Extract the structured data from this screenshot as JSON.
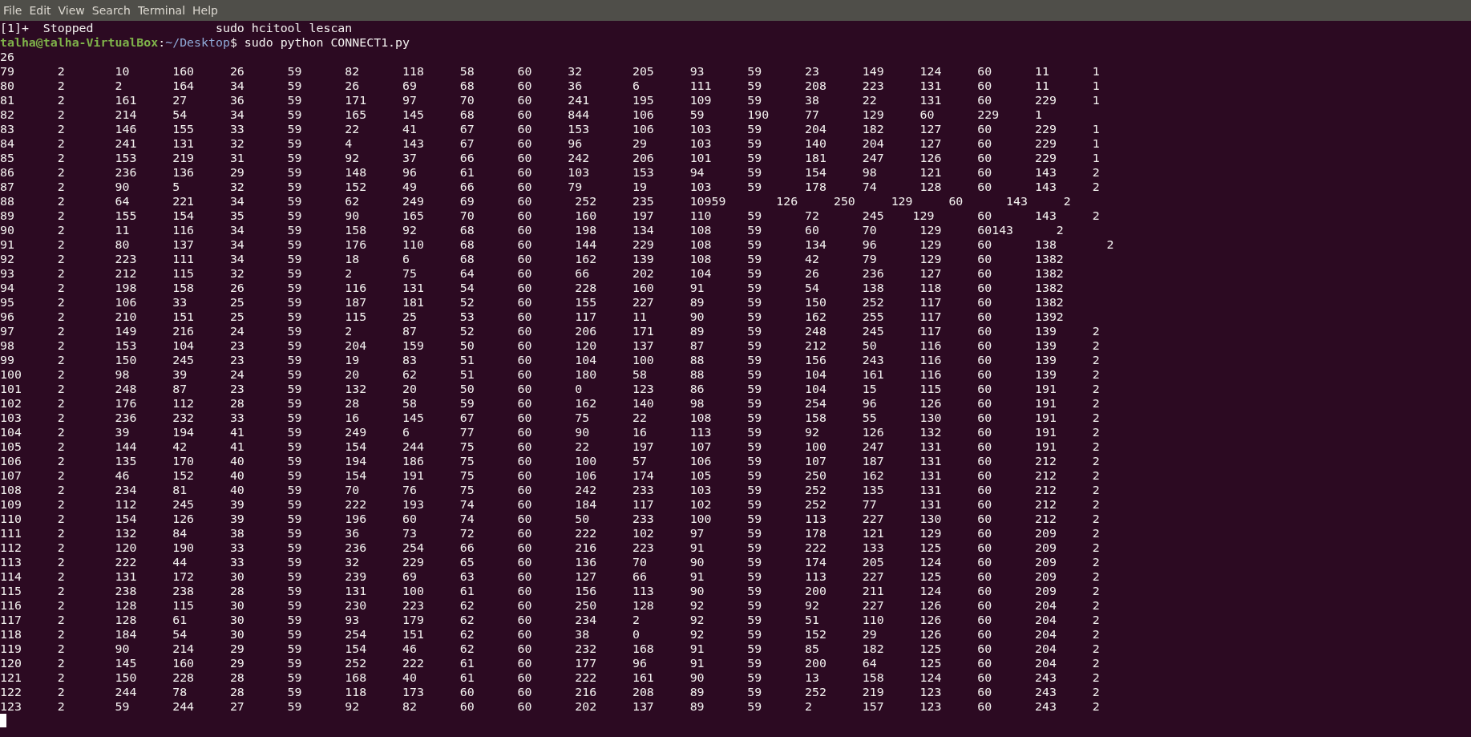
{
  "menu": [
    "File",
    "Edit",
    "View",
    "Search",
    "Terminal",
    "Help"
  ],
  "terminal": {
    "job_line": "[1]+  Stopped                 sudo hcitool lescan",
    "prompt": {
      "user_host": "talha@talha-VirtualBox",
      "separator": ":",
      "path": "~/Desktop",
      "symbol": "$",
      "command": " sudo python CONNECT1.py"
    },
    "output_lines": [
      "26",
      "79\t2\t10\t160\t26\t59\t82\t118\t58\t60     32\t205\t93\t59\t23\t149\t124\t60\t11\t1",
      "80\t2\t2\t164\t34\t59\t26\t69\t68\t60     36\t6\t111\t59\t208\t223\t131\t60\t11\t1",
      "81\t2\t161\t27\t36\t59\t171\t97\t70\t60     241\t195\t109\t59\t38\t22\t131\t60\t229\t1",
      "82\t2\t214\t54\t34\t59\t165\t145\t68\t60     844\t106\t59\t190\t77\t129\t60\t229\t1",
      "83\t2\t146\t155\t33\t59\t22\t41\t67\t60     153\t106\t103\t59\t204\t182\t127\t60\t229\t1",
      "84\t2\t241\t131\t32\t59\t4\t143\t67\t60     96\t29\t103\t59\t140\t204\t127\t60\t229\t1",
      "85\t2\t153\t219\t31\t59\t92\t37\t66\t60     242\t206\t101\t59\t181\t247\t126\t60\t229\t1",
      "86\t2\t236\t136\t29\t59\t148\t96\t61\t60     103\t153\t94\t59\t154\t98\t121\t60\t143\t2",
      "87\t2\t90\t5\t32\t59\t152\t49\t66\t60     79\t19\t103\t59\t178\t74\t128\t60\t143\t2",
      "88\t2\t64\t221\t34\t59\t62\t249\t69\t60\t252\t235\t10959       126     250     129     60      143     2",
      "89\t2\t155\t154\t35\t59\t90\t165\t70\t60\t160\t197\t110\t59\t72\t245    129\t60\t143\t2",
      "90\t2\t11\t116\t34\t59\t158\t92\t68\t60\t198\t134\t108\t59\t60\t70\t129\t60143      2",
      "91\t2\t80\t137\t34\t59\t176\t110\t68\t60\t144\t229\t108\t59\t134\t96\t129\t60\t138       2",
      "92\t2\t223\t111\t34\t59\t18\t6\t68\t60\t162\t139\t108\t59\t42\t79\t129\t60\t1382",
      "93\t2\t212\t115\t32\t59\t2\t75\t64\t60\t66\t202\t104\t59\t26\t236\t127\t60\t1382",
      "94\t2\t198\t158\t26\t59\t116\t131\t54\t60\t228\t160\t91\t59\t54\t138\t118\t60\t1382",
      "95\t2\t106\t33\t25\t59\t187\t181\t52\t60\t155\t227\t89\t59\t150\t252\t117\t60\t1382",
      "96\t2\t210\t151\t25\t59\t115\t25\t53\t60\t117\t11\t90\t59\t162\t255\t117\t60\t1392",
      "97\t2\t149\t216\t24\t59\t2\t87\t52\t60\t206\t171\t89\t59\t248\t245\t117\t60\t139\t2",
      "98\t2\t153\t104\t23\t59\t204\t159\t50\t60\t120\t137\t87\t59\t212\t50\t116\t60\t139\t2",
      "99\t2\t150\t245\t23\t59\t19\t83\t51\t60\t104\t100\t88\t59\t156\t243\t116\t60\t139\t2",
      "100\t2\t98\t39\t24\t59\t20\t62\t51\t60\t180\t58\t88\t59\t104\t161\t116\t60\t139\t2",
      "101\t2\t248\t87\t23\t59\t132\t20\t50\t60\t0\t123\t86\t59\t104\t15\t115\t60\t191\t2",
      "102\t2\t176\t112\t28\t59\t28\t58\t59\t60\t162\t140\t98\t59\t254\t96\t126\t60\t191\t2",
      "103\t2\t236\t232\t33\t59\t16\t145\t67\t60\t75\t22\t108\t59\t158\t55\t130\t60\t191\t2",
      "104\t2\t39\t194\t41\t59\t249\t6\t77\t60\t90\t16\t113\t59\t92\t126\t132\t60\t191\t2",
      "105\t2\t144\t42\t41\t59\t154\t244\t75\t60\t22\t197\t107\t59\t100\t247\t131\t60\t191\t2",
      "106\t2\t135\t170\t40\t59\t194\t186\t75\t60\t100\t57\t106\t59\t107\t187\t131\t60\t212\t2",
      "107\t2\t46\t152\t40\t59\t154\t191\t75\t60\t106\t174\t105\t59\t250\t162\t131\t60\t212\t2",
      "108\t2\t234\t81\t40\t59\t70\t76\t75\t60\t242\t233\t103\t59\t252\t135\t131\t60\t212\t2",
      "109\t2\t112\t245\t39\t59\t222\t193\t74\t60\t184\t117\t102\t59\t252\t77\t131\t60\t212\t2",
      "110\t2\t154\t126\t39\t59\t196\t60\t74\t60\t50\t233\t100\t59\t113\t227\t130\t60\t212\t2",
      "111\t2\t132\t84\t38\t59\t36\t73\t72\t60\t222\t102\t97\t59\t178\t121\t129\t60\t209\t2",
      "112\t2\t120\t190\t33\t59\t236\t254\t66\t60\t216\t223\t91\t59\t222\t133\t125\t60\t209\t2",
      "113\t2\t222\t44\t33\t59\t32\t229\t65\t60\t136\t70\t90\t59\t174\t205\t124\t60\t209\t2",
      "114\t2\t131\t172\t30\t59\t239\t69\t63\t60\t127\t66\t91\t59\t113\t227\t125\t60\t209\t2",
      "115\t2\t238\t238\t28\t59\t131\t100\t61\t60\t156\t113\t90\t59\t200\t211\t124\t60\t209\t2",
      "116\t2\t128\t115\t30\t59\t230\t223\t62\t60\t250\t128\t92\t59\t92\t227\t126\t60\t204\t2",
      "117\t2\t128\t61\t30\t59\t93\t179\t62\t60\t234\t2\t92\t59\t51\t110\t126\t60\t204\t2",
      "118\t2\t184\t54\t30\t59\t254\t151\t62\t60\t38\t0\t92\t59\t152\t29\t126\t60\t204\t2",
      "119\t2\t90\t214\t29\t59\t154\t46\t62\t60\t232\t168\t91\t59\t85\t182\t125\t60\t204\t2",
      "120\t2\t145\t160\t29\t59\t252\t222\t61\t60\t177\t96\t91\t59\t200\t64\t125\t60\t204\t2",
      "121\t2\t150\t228\t28\t59\t168\t40\t61\t60\t222\t161\t90\t59\t13\t158\t124\t60\t243\t2",
      "122\t2\t244\t78\t28\t59\t118\t173\t60\t60\t216\t208\t89\t59\t252\t219\t123\t60\t243\t2",
      "123\t2\t59\t244\t27\t59\t92\t82\t60\t60\t202\t137\t89\t59\t2\t157\t123\t60\t243\t2"
    ]
  }
}
